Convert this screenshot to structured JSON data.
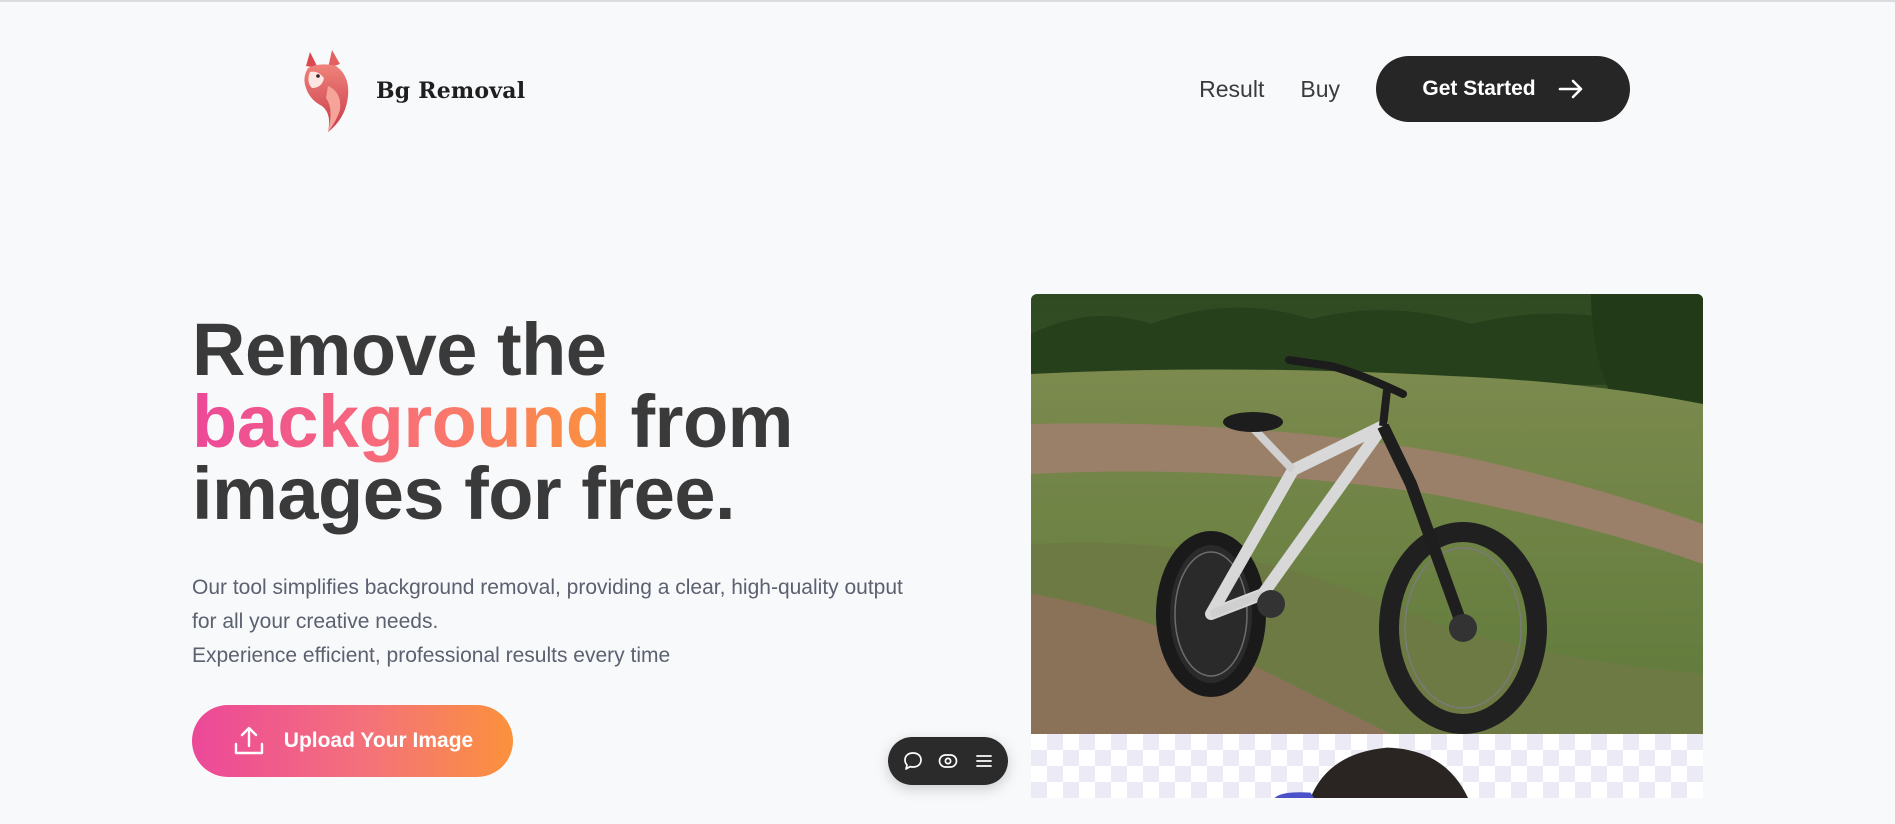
{
  "brand": {
    "name": "Bg Removal",
    "icon": "fox-logo-icon"
  },
  "nav": {
    "links": [
      "Result",
      "Buy"
    ],
    "cta_label": "Get Started",
    "cta_icon": "arrow-right-icon"
  },
  "hero": {
    "title_line1": "Remove the",
    "title_highlight": "background",
    "title_after_highlight": " from",
    "title_line3": "images for free.",
    "desc_line1": "Our tool simplifies background removal, providing a clear, high-quality output",
    "desc_line2": "for all your creative needs.",
    "desc_line3": "Experience efficient, professional results every time",
    "upload_label": "Upload Your Image",
    "upload_icon": "upload-icon"
  },
  "colors": {
    "gradient_start": "#ec4899",
    "gradient_end": "#fb923c",
    "dark": "#262626",
    "background": "#f8f9fb"
  },
  "floating_toolbar": {
    "icons": [
      "chat-bubble-icon",
      "eye-icon",
      "menu-icon"
    ]
  }
}
